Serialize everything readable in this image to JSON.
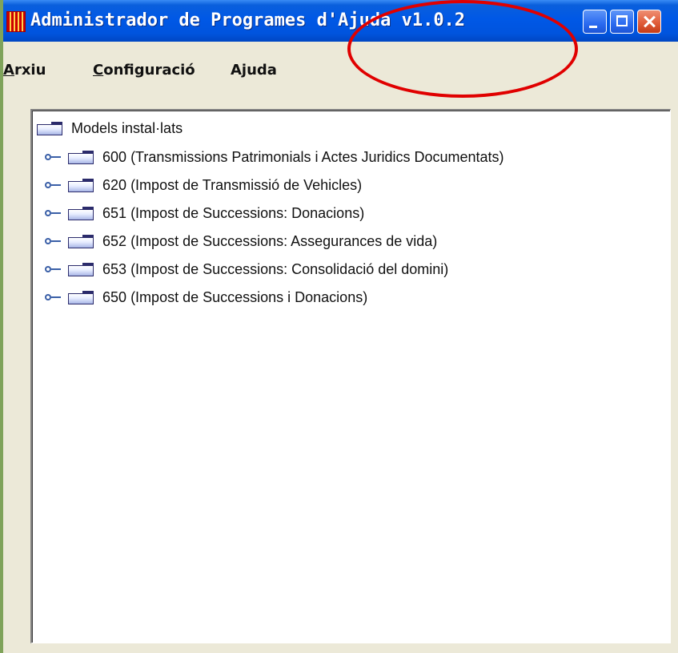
{
  "window": {
    "title": "Administrador de Programes d'Ajuda v1.0.2",
    "app_icon": "app-logo-icon",
    "controls": {
      "minimize": "minimize-icon",
      "maximize": "maximize-icon",
      "close": "close-icon"
    }
  },
  "menubar": {
    "items": [
      {
        "mnemonic": "A",
        "rest": "rxiu"
      },
      {
        "mnemonic": "C",
        "rest": "onfiguració"
      },
      {
        "mnemonic": "",
        "rest": "Ajuda"
      }
    ]
  },
  "tree": {
    "root_label": "Models instal·lats",
    "items": [
      {
        "label": "600 (Transmissions Patrimonials i Actes Juridics Documentats)"
      },
      {
        "label": "620 (Impost de Transmissió de Vehicles)"
      },
      {
        "label": "651 (Impost de Successions: Donacions)"
      },
      {
        "label": "652 (Impost de Successions: Assegurances de vida)"
      },
      {
        "label": "653 (Impost de Successions: Consolidació del domini)"
      },
      {
        "label": "650 (Impost de Successions i Donacions)"
      }
    ]
  },
  "colors": {
    "titlebar": "#0054de",
    "annotation": "#e00000",
    "window_bg": "#ece9d8"
  }
}
